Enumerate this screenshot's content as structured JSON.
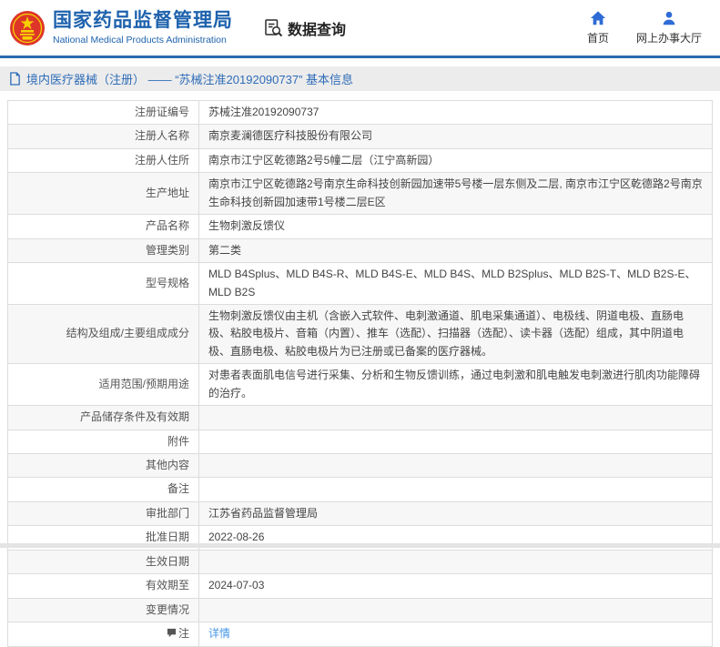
{
  "header": {
    "agency_name_zh": "国家药品监督管理局",
    "agency_name_en": "National Medical Products Administration",
    "section_title": "数据查询",
    "nav": [
      {
        "label": "首页",
        "icon": "home-icon"
      },
      {
        "label": "网上办事大厅",
        "icon": "person-icon"
      }
    ]
  },
  "breadcrumb": {
    "text": "境内医疗器械（注册） —— “苏械注准20192090737” 基本信息"
  },
  "table": {
    "rows": [
      {
        "label": "注册证编号",
        "value": "苏械注准20192090737"
      },
      {
        "label": "注册人名称",
        "value": "南京麦澜德医疗科技股份有限公司"
      },
      {
        "label": "注册人住所",
        "value": "南京市江宁区乾德路2号5幢二层（江宁高新园）"
      },
      {
        "label": "生产地址",
        "value": "南京市江宁区乾德路2号南京生命科技创新园加速带5号楼一层东侧及二层, 南京市江宁区乾德路2号南京生命科技创新园加速带1号楼二层E区"
      },
      {
        "label": "产品名称",
        "value": "生物刺激反馈仪"
      },
      {
        "label": "管理类别",
        "value": "第二类"
      },
      {
        "label": "型号规格",
        "value": "MLD B4Splus、MLD B4S-R、MLD B4S-E、MLD B4S、MLD B2Splus、MLD B2S-T、MLD B2S-E、MLD B2S"
      },
      {
        "label": "结构及组成/主要组成成分",
        "value": "生物刺激反馈仪由主机（含嵌入式软件、电刺激通道、肌电采集通道）、电极线、阴道电极、直肠电极、粘胶电极片、音箱（内置）、推车（选配）、扫描器（选配）、读卡器（选配）组成，其中阴道电极、直肠电极、粘胶电极片为已注册或已备案的医疗器械。"
      },
      {
        "label": "适用范围/预期用途",
        "value": "对患者表面肌电信号进行采集、分析和生物反馈训练，通过电刺激和肌电触发电刺激进行肌肉功能障碍的治疗。"
      },
      {
        "label": "产品储存条件及有效期",
        "value": ""
      },
      {
        "label": "附件",
        "value": ""
      },
      {
        "label": "其他内容",
        "value": ""
      },
      {
        "label": "备注",
        "value": ""
      },
      {
        "label": "审批部门",
        "value": "江苏省药品监督管理局"
      },
      {
        "label": "批准日期",
        "value": "2022-08-26"
      },
      {
        "label": "生效日期",
        "value": ""
      },
      {
        "label": "有效期至",
        "value": "2024-07-03"
      },
      {
        "label": "变更情况",
        "value": ""
      },
      {
        "label": "注",
        "value": "详情",
        "value_type": "link",
        "label_icon": "note-icon"
      }
    ]
  },
  "colors": {
    "brand_blue": "#1e62ad",
    "header_border_blue": "#2a6ab0",
    "nav_icon_blue": "#2e6bd6",
    "breadcrumb_text_blue": "#2e6cb8",
    "link_blue": "#4596e8",
    "emblem_red": "#dd3629",
    "emblem_gold": "#f7d000",
    "alt_row_gray": "#f7f7f7",
    "border_gray": "#dcdcdc"
  }
}
